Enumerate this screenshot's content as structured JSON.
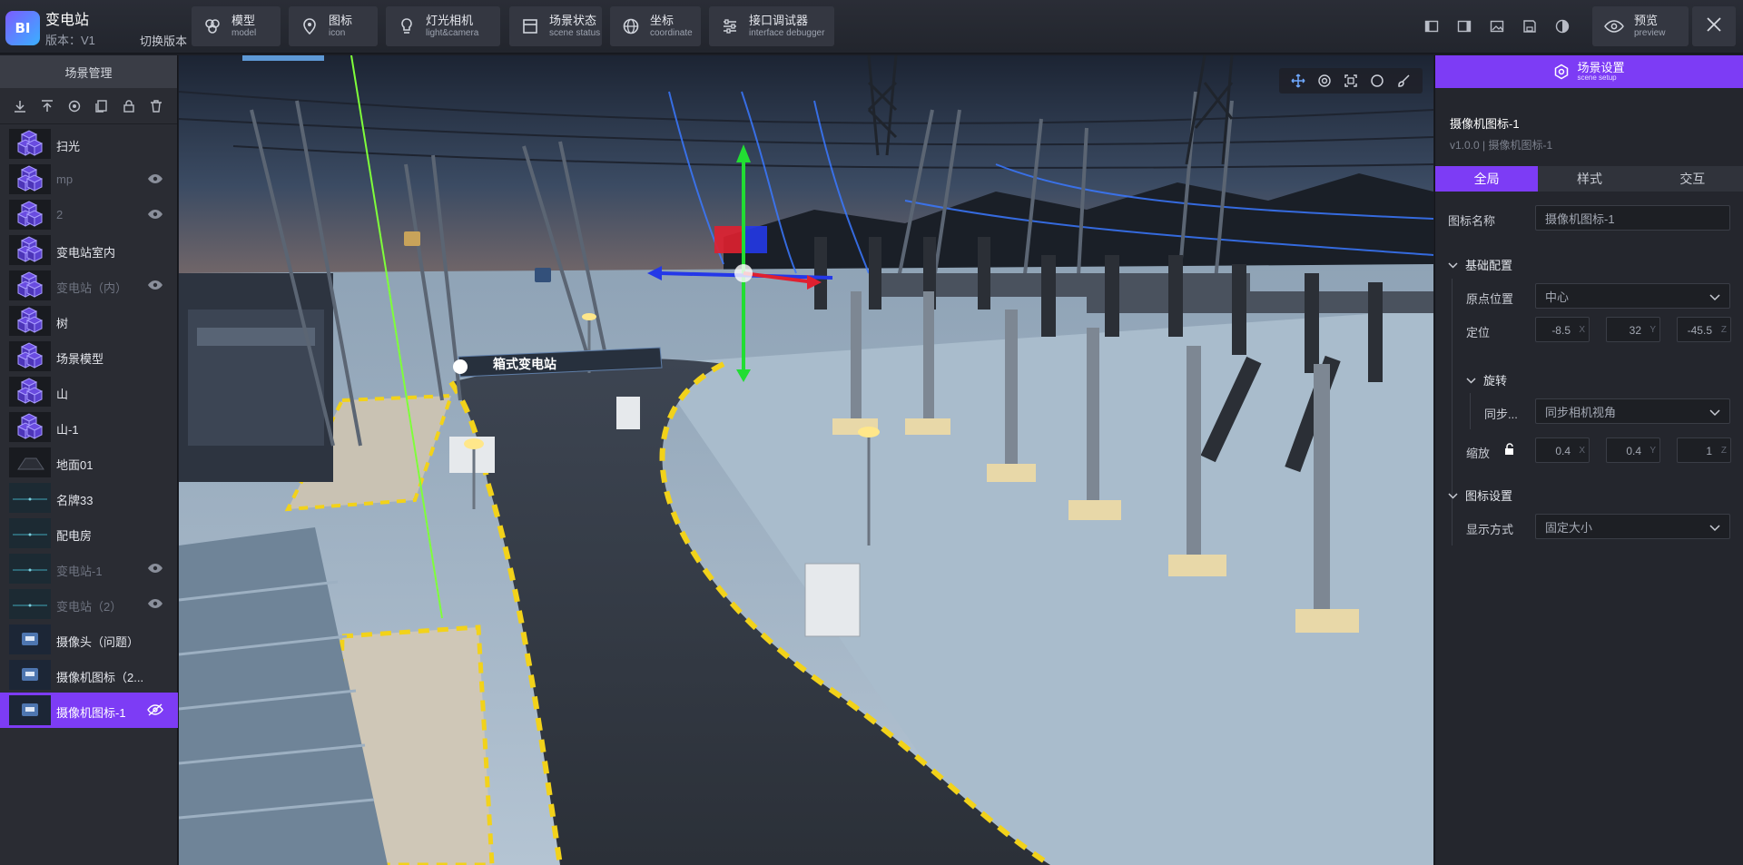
{
  "app": {
    "logo_text": "BI",
    "title": "变电站",
    "version": "版本：V1",
    "switch_version": "切换版本"
  },
  "top_tools": [
    {
      "cn": "模型",
      "en": "model",
      "icon": "model-icon"
    },
    {
      "cn": "图标",
      "en": "icon",
      "icon": "map-pin-icon"
    },
    {
      "cn": "灯光相机",
      "en": "light&camera",
      "icon": "bulb-icon"
    },
    {
      "cn": "场景状态",
      "en": "scene status",
      "icon": "scene-status-icon"
    },
    {
      "cn": "坐标",
      "en": "coordinate",
      "icon": "globe-icon"
    },
    {
      "cn": "接口调试器",
      "en": "interface debugger",
      "icon": "sliders-icon"
    }
  ],
  "preview": {
    "cn": "预览",
    "en": "preview"
  },
  "left_panel": {
    "title": "场景管理",
    "toolbar": [
      "download-icon",
      "upload-icon",
      "locate-icon",
      "copy-icon",
      "lock-icon",
      "trash-icon"
    ],
    "layers": [
      {
        "name": "扫光",
        "dim": false,
        "eye": false,
        "thumb": "cube"
      },
      {
        "name": "mp",
        "dim": true,
        "eye": true,
        "thumb": "cube"
      },
      {
        "name": "2",
        "dim": true,
        "eye": true,
        "thumb": "cube"
      },
      {
        "name": "变电站室内",
        "dim": false,
        "eye": false,
        "thumb": "cube"
      },
      {
        "name": "变电站（内）",
        "dim": true,
        "eye": true,
        "thumb": "cube"
      },
      {
        "name": "树",
        "dim": false,
        "eye": false,
        "thumb": "cube"
      },
      {
        "name": "场景模型",
        "dim": false,
        "eye": false,
        "thumb": "cube"
      },
      {
        "name": "山",
        "dim": false,
        "eye": false,
        "thumb": "cube"
      },
      {
        "name": "山-1",
        "dim": false,
        "eye": false,
        "thumb": "cube"
      },
      {
        "name": "地面01",
        "dim": false,
        "eye": false,
        "thumb": "plane"
      },
      {
        "name": "名牌33",
        "dim": false,
        "eye": false,
        "thumb": "dark"
      },
      {
        "name": "配电房",
        "dim": false,
        "eye": false,
        "thumb": "dark"
      },
      {
        "name": "变电站-1",
        "dim": true,
        "eye": true,
        "thumb": "dark"
      },
      {
        "name": "变电站（2）",
        "dim": true,
        "eye": true,
        "thumb": "dark"
      },
      {
        "name": "摄像头（问题）",
        "dim": false,
        "eye": false,
        "thumb": "cam"
      },
      {
        "name": "摄像机图标（2...",
        "dim": false,
        "eye": false,
        "thumb": "cam"
      },
      {
        "name": "摄像机图标-1",
        "dim": false,
        "eye": true,
        "thumb": "cam",
        "selected": true
      }
    ]
  },
  "viewport": {
    "label": "箱式变电站",
    "toolbar": [
      "move-icon",
      "rotate-icon",
      "scale-icon",
      "circle-icon",
      "brush-icon"
    ]
  },
  "right_panel": {
    "header": {
      "cn": "场景设置",
      "en": "scene setup"
    },
    "object_name": "摄像机图标-1",
    "object_version": "v1.0.0 | 摄像机图标-1",
    "tabs": [
      "全局",
      "样式",
      "交互"
    ],
    "icon_name_label": "图标名称",
    "icon_name_value": "摄像机图标-1",
    "basic_section": "基础配置",
    "origin_label": "原点位置",
    "origin_value": "中心",
    "position_label": "定位",
    "position": {
      "x": "-8.5",
      "y": "32",
      "z": "-45.5"
    },
    "rotation_section": "旋转",
    "sync_label": "同步...",
    "sync_value": "同步相机视角",
    "scale_label": "缩放",
    "scale": {
      "x": "0.4",
      "y": "0.4",
      "z": "1"
    },
    "icon_section": "图标设置",
    "display_label": "显示方式",
    "display_value": "固定大小"
  },
  "colors": {
    "accent": "#7d3cf5",
    "panel": "#2a2c33",
    "topbar": "#2a2d36"
  }
}
